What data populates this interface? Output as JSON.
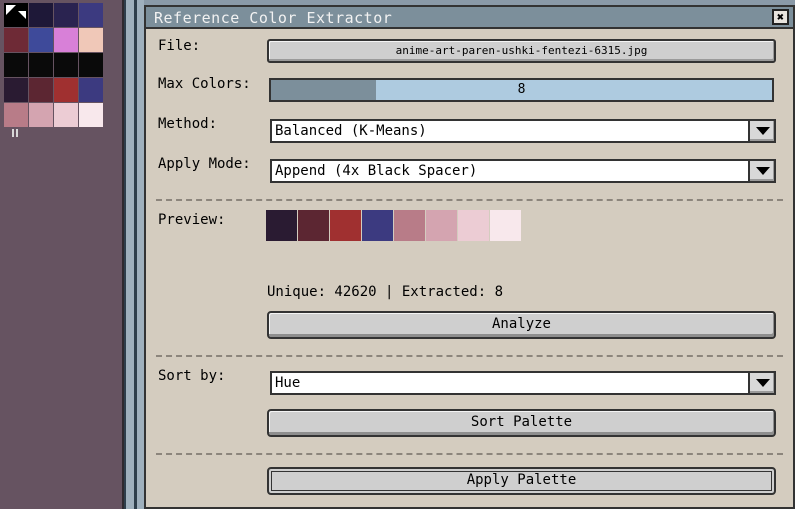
{
  "palette": {
    "colors": [
      "#000000",
      "#1e1838",
      "#2a2350",
      "#3c3a80",
      "#6e2a36",
      "#3e4a9a",
      "#d880d8",
      "#f0c8b8",
      "#0a0a0a",
      "#0a0a0a",
      "#0a0a0a",
      "#0a0a0a",
      "#2a1b32",
      "#5c2632",
      "#a03030",
      "#3c3a80",
      "#b87c88",
      "#d4a4b0",
      "#ecccd4",
      "#f8e8ec"
    ],
    "columns": 4
  },
  "dialog": {
    "title": "Reference Color Extractor",
    "close_label": "✖",
    "file": {
      "label": "File:",
      "value": "anime-art-paren-ushki-fentezi-6315.jpg"
    },
    "max_colors": {
      "label": "Max Colors:",
      "value": "8",
      "fill_fraction": 0.21
    },
    "method": {
      "label": "Method:",
      "selected": "Balanced (K-Means)"
    },
    "apply_mode": {
      "label": "Apply Mode:",
      "selected": "Append (4x Black Spacer)"
    },
    "preview": {
      "label": "Preview:",
      "colors": [
        "#2a1b32",
        "#5c2632",
        "#a03030",
        "#3c3a80",
        "#b87c88",
        "#d4a4b0",
        "#ecccd4",
        "#f8e8ec"
      ]
    },
    "stats": "Unique: 42620 | Extracted: 8",
    "analyze_label": "Analyze",
    "sort": {
      "label": "Sort by:",
      "selected": "Hue"
    },
    "sort_palette_label": "Sort Palette",
    "apply_palette_label": "Apply Palette"
  },
  "colors": {
    "dialog_bg": "#d4ccbf",
    "titlebar": "#7c8f9b",
    "slider_track": "#aecbe0",
    "palette_panel_bg": "#665361"
  }
}
